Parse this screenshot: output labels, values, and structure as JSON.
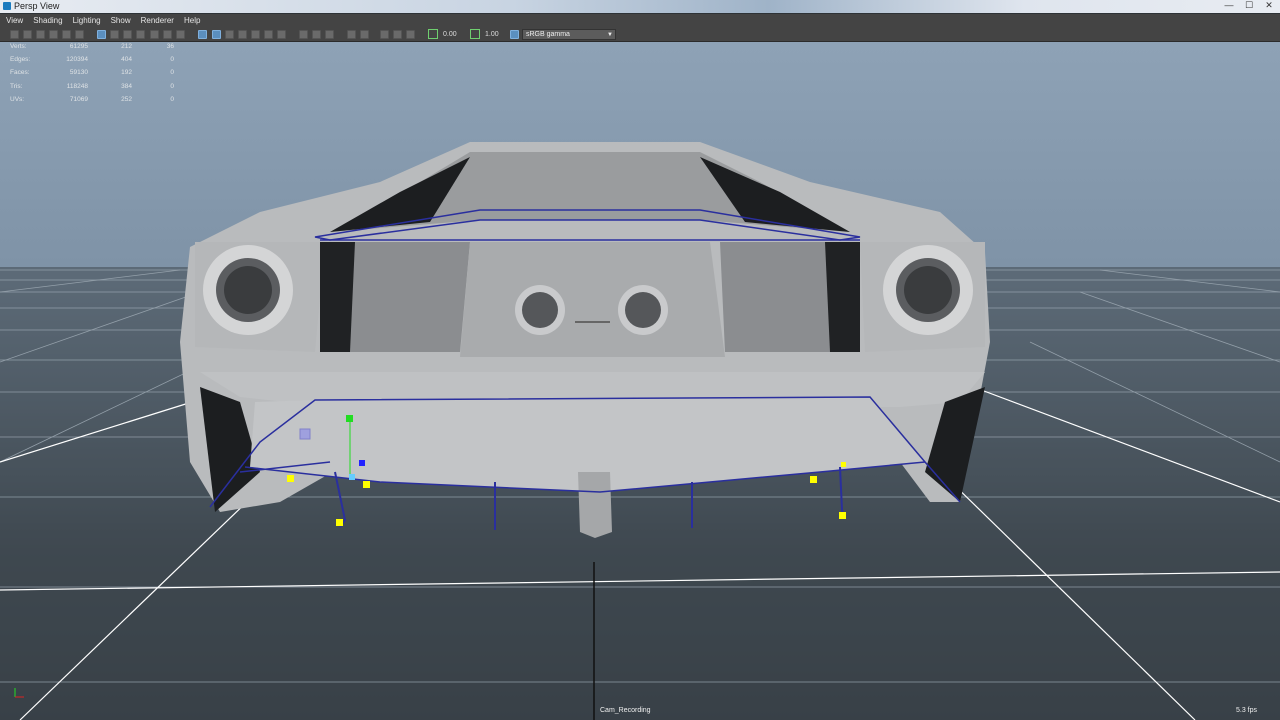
{
  "window": {
    "title": "Persp View"
  },
  "window_controls": {
    "minimize": "—",
    "maximize": "☐",
    "close": "✕"
  },
  "menu": [
    "View",
    "Shading",
    "Lighting",
    "Show",
    "Renderer",
    "Help"
  ],
  "toolbar": {
    "exposure_value": "0.00",
    "gamma_value": "1.00",
    "color_space": "sRGB gamma",
    "color_space_arrow": "▼"
  },
  "hud": {
    "rows": [
      {
        "label": "Verts:",
        "a": "61295",
        "b": "212",
        "c": "36"
      },
      {
        "label": "Edges:",
        "a": "120394",
        "b": "404",
        "c": "0"
      },
      {
        "label": "Faces:",
        "a": "59130",
        "b": "192",
        "c": "0"
      },
      {
        "label": "Tris:",
        "a": "118248",
        "b": "384",
        "c": "0"
      },
      {
        "label": "UVs:",
        "a": "71069",
        "b": "252",
        "c": "0"
      }
    ]
  },
  "camera_name": "Cam_Recording",
  "fps": "5.3 fps",
  "colors": {
    "selection_edge": "#2a2f9e",
    "vertex_handle": "#ffff00",
    "manipulator_y": "#22dd22",
    "manipulator_z": "#2222ff",
    "manipulator_x": "#66ccff",
    "grid_line": "#ffffff"
  }
}
